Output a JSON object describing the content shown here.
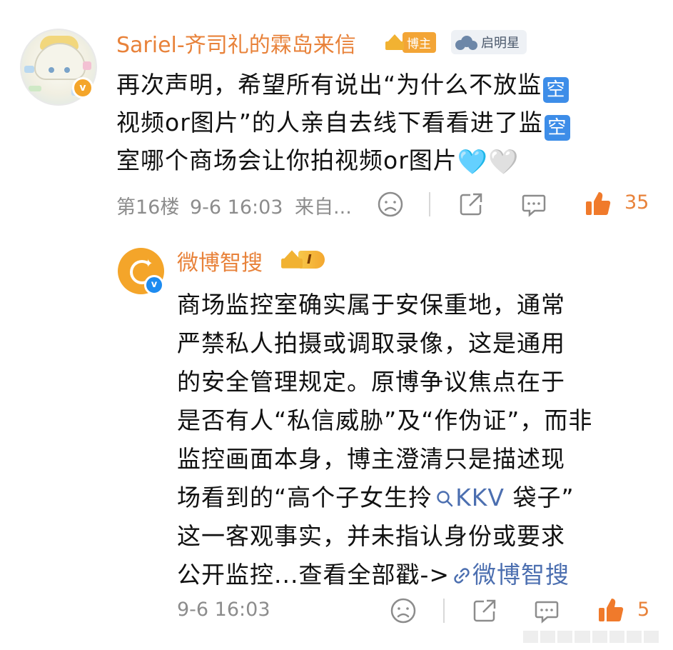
{
  "comment": {
    "username": "Sariel-齐司礼的霖岛来信",
    "verified_mark": "v",
    "badge_host": "博主",
    "badge_star": "启明星",
    "content_lines": [
      "再次声明，希望所有说出“为什么不放监",
      "视频or图片”的人亲自去线下看看进了监",
      "室哪个商场会让你拍视频or图片"
    ],
    "emoji_square": "空",
    "hearts": [
      "🩵",
      "🤍"
    ],
    "floor": "第16楼",
    "time": "9-6 16:03",
    "source": "来自...",
    "likes": "35"
  },
  "reply": {
    "username": "微博智搜",
    "verified_mark": "v",
    "vip_level": "I",
    "content_lines": [
      "商场监控室确实属于安保重地，通常",
      "严禁私人拍摄或调取录像，这是通用",
      "的安全管理规定。原博争议焦点在于",
      "是否有人“私信威胁”及“作伪证”，而非",
      "监控画面本身，博主澄清只是描述现",
      "场看到的“高个子女生拎",
      "这一客观事实，并未指认身份或要求",
      "公开监控...查看全部戳->"
    ],
    "search_keyword": "KKV",
    "line6_tail": " 袋子”",
    "link_text": "微博智搜",
    "time": "9-6 16:03",
    "likes": "5"
  },
  "colors": {
    "username": "#e8823a",
    "like": "#f07a2b",
    "meta": "#8c8c8c",
    "link": "#4c6fb0"
  },
  "icons": [
    "emoji-face-icon",
    "share-icon",
    "comment-icon",
    "thumbs-up-icon",
    "search-icon",
    "link-icon"
  ]
}
